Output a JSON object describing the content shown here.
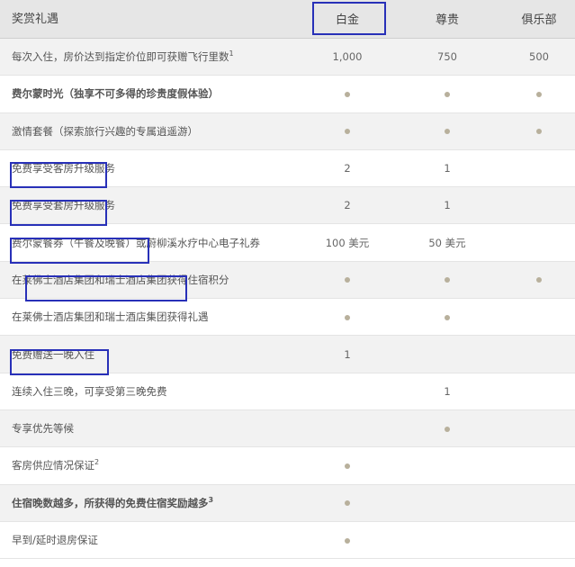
{
  "header": {
    "label": "奖赏礼遇",
    "columns": [
      "白金",
      "尊贵",
      "俱乐部"
    ]
  },
  "rows": [
    {
      "label": "每次入住，房价达到指定价位即可获赠飞行里数",
      "sup": "1",
      "bold": false,
      "values": [
        "1,000",
        "750",
        "500"
      ]
    },
    {
      "label": "费尔蒙时光（独享不可多得的珍贵度假体验）",
      "sup": "",
      "bold": true,
      "values": [
        "●",
        "●",
        "●"
      ]
    },
    {
      "label": "激情套餐（探索旅行兴趣的专属逍遥游）",
      "sup": "",
      "bold": false,
      "values": [
        "●",
        "●",
        "●"
      ]
    },
    {
      "label": "免费享受客房升级服务",
      "sup": "",
      "bold": false,
      "values": [
        "2",
        "1",
        ""
      ]
    },
    {
      "label": "免费享受套房升级服务",
      "sup": "",
      "bold": false,
      "values": [
        "2",
        "1",
        ""
      ]
    },
    {
      "label": "费尔蒙餐券（午餐及晚餐）或蔚柳溪水疗中心电子礼券",
      "sup": "",
      "bold": false,
      "values": [
        "100 美元",
        "50 美元",
        ""
      ]
    },
    {
      "label": "在莱佛士酒店集团和瑞士酒店集团获得住宿积分",
      "sup": "",
      "bold": false,
      "values": [
        "●",
        "●",
        "●"
      ]
    },
    {
      "label": "在莱佛士酒店集团和瑞士酒店集团获得礼遇",
      "sup": "",
      "bold": false,
      "values": [
        "●",
        "●",
        ""
      ]
    },
    {
      "label": "免费赠送一晚入住",
      "sup": "",
      "bold": false,
      "values": [
        "1",
        "",
        ""
      ]
    },
    {
      "label": "连续入住三晚，可享受第三晚免费",
      "sup": "",
      "bold": false,
      "values": [
        "",
        "1",
        ""
      ]
    },
    {
      "label": "专享优先等候",
      "sup": "",
      "bold": false,
      "values": [
        "",
        "●",
        ""
      ]
    },
    {
      "label": "客房供应情况保证",
      "sup": "2",
      "bold": false,
      "values": [
        "●",
        "",
        ""
      ]
    },
    {
      "label": "住宿晚数越多，所获得的免费住宿奖励越多",
      "sup": "3",
      "bold": true,
      "values": [
        "●",
        "",
        ""
      ]
    },
    {
      "label": "早到/延时退房保证",
      "sup": "",
      "bold": false,
      "values": [
        "●",
        "",
        ""
      ]
    }
  ],
  "colors": {
    "highlight_box": "#2830b8",
    "header_bg": "#e6e6e6",
    "alt_row_bg": "#f2f2f2",
    "dot": "#b8b09c"
  }
}
